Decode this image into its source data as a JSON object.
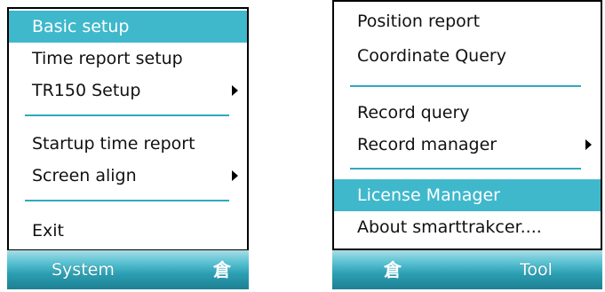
{
  "left_panel": {
    "menu": {
      "items": [
        {
          "label": "Basic setup",
          "highlighted": true,
          "submenu": false
        },
        {
          "label": "Time report setup",
          "highlighted": false,
          "submenu": false
        },
        {
          "label": "TR150 Setup",
          "highlighted": false,
          "submenu": true
        },
        {
          "label": "Startup time report",
          "highlighted": false,
          "submenu": false
        },
        {
          "label": "Screen align",
          "highlighted": false,
          "submenu": true
        },
        {
          "label": "Exit",
          "highlighted": false,
          "submenu": false
        }
      ]
    },
    "softbar": {
      "left_label": "System",
      "ime_glyph": "倉"
    }
  },
  "right_panel": {
    "menu": {
      "items": [
        {
          "label": "Position report",
          "highlighted": false,
          "submenu": false
        },
        {
          "label": "Coordinate Query",
          "highlighted": false,
          "submenu": false
        },
        {
          "label": "Record query",
          "highlighted": false,
          "submenu": false
        },
        {
          "label": "Record manager",
          "highlighted": false,
          "submenu": true
        },
        {
          "label": "License Manager",
          "highlighted": true,
          "submenu": false
        },
        {
          "label": "About smarttrakcer....",
          "highlighted": false,
          "submenu": false
        }
      ]
    },
    "softbar": {
      "ime_glyph": "倉",
      "right_label": "Tool"
    }
  },
  "colors": {
    "highlight": "#3fb8cc",
    "separator": "#2fa9bd",
    "softbar_dark": "#1d7f92"
  }
}
